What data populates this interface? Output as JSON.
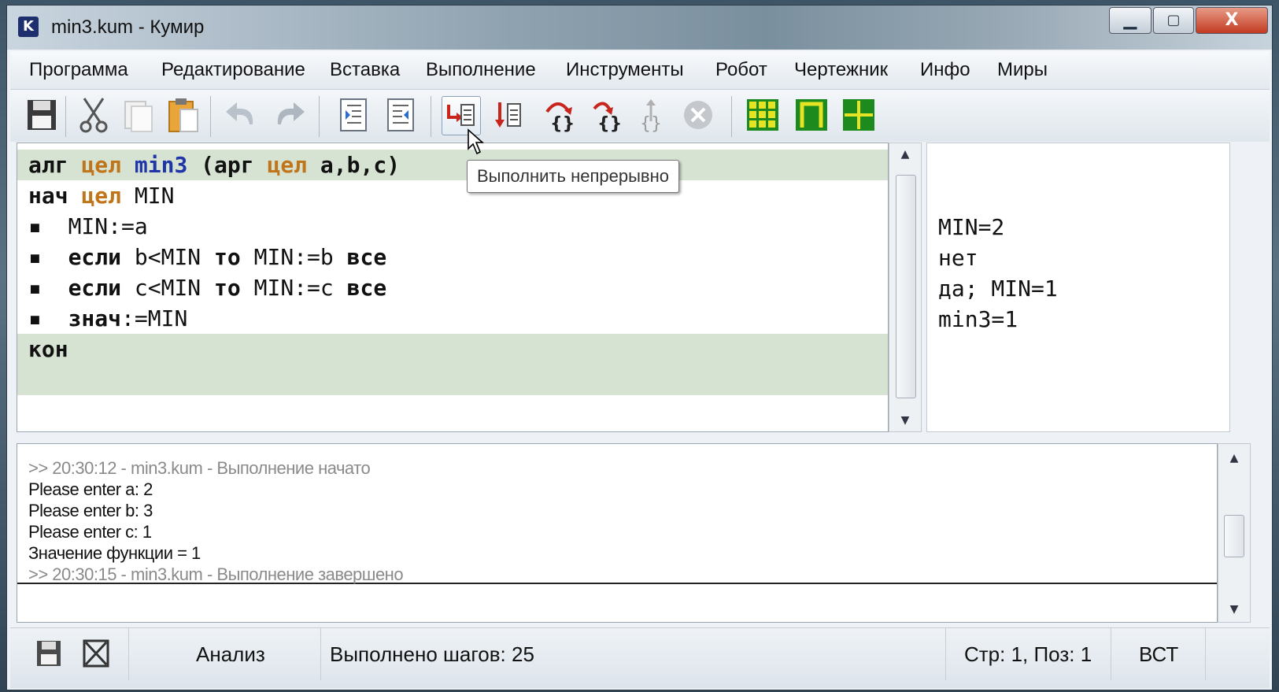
{
  "window": {
    "title": "min3.kum - Кумир",
    "app_icon_letter": "K",
    "min_glyph": "▁",
    "max_glyph": "▢",
    "close_glyph": "X"
  },
  "menu": [
    "Программа",
    "Редактирование",
    "Вставка",
    "Выполнение",
    "Инструменты",
    "Робот",
    "Чертежник",
    "Инфо",
    "Миры"
  ],
  "toolbar": {
    "tooltip": "Выполнить непрерывно",
    "icons": [
      "save-icon",
      "cut-icon",
      "copy-icon",
      "paste-icon",
      "undo-icon",
      "redo-icon",
      "indent-icon",
      "unindent-icon",
      "run-continuous-icon",
      "run-step-icon",
      "step-over-icon",
      "step-into-icon",
      "step-out-icon",
      "stop-icon",
      "robot-field-icon",
      "robot-window-icon",
      "drawer-icon"
    ]
  },
  "editor": {
    "lines": [
      {
        "tokens": [
          [
            "kw",
            "алг"
          ],
          [
            "sp",
            " "
          ],
          [
            "ty",
            "цел"
          ],
          [
            "sp",
            " "
          ],
          [
            "fn",
            "min3"
          ],
          [
            "sp",
            " "
          ],
          [
            "kw",
            "(арг"
          ],
          [
            "sp",
            " "
          ],
          [
            "ty",
            "цел"
          ],
          [
            "sp",
            " "
          ],
          [
            "kw",
            "a,b,c)"
          ]
        ]
      },
      {
        "tokens": [
          [
            "kw",
            "нач"
          ],
          [
            "sp",
            " "
          ],
          [
            "ty",
            "цел"
          ],
          [
            "sp",
            " "
          ],
          [
            "nm",
            "MIN"
          ]
        ]
      },
      {
        "tokens": [
          [
            "bul",
            "▪"
          ],
          [
            "sp",
            "  "
          ],
          [
            "nm",
            "MIN:=a"
          ]
        ]
      },
      {
        "tokens": [
          [
            "bul",
            "▪"
          ],
          [
            "sp",
            "  "
          ],
          [
            "kw",
            "если"
          ],
          [
            "sp",
            " "
          ],
          [
            "nm",
            "b<MIN"
          ],
          [
            "sp",
            " "
          ],
          [
            "kw",
            "то"
          ],
          [
            "sp",
            " "
          ],
          [
            "nm",
            "MIN:=b"
          ],
          [
            "sp",
            " "
          ],
          [
            "kw",
            "все"
          ]
        ]
      },
      {
        "tokens": [
          [
            "bul",
            "▪"
          ],
          [
            "sp",
            "  "
          ],
          [
            "kw",
            "если"
          ],
          [
            "sp",
            " "
          ],
          [
            "nm",
            "c<MIN"
          ],
          [
            "sp",
            " "
          ],
          [
            "kw",
            "то"
          ],
          [
            "sp",
            " "
          ],
          [
            "nm",
            "MIN:=c"
          ],
          [
            "sp",
            " "
          ],
          [
            "kw",
            "все"
          ]
        ]
      },
      {
        "tokens": [
          [
            "bul",
            "▪"
          ],
          [
            "sp",
            "  "
          ],
          [
            "kw",
            "знач"
          ],
          [
            "nm",
            ":=MIN"
          ]
        ]
      },
      {
        "tokens": [
          [
            "kw",
            "кон"
          ]
        ]
      }
    ]
  },
  "margin": [
    "MIN=2",
    "нет",
    "да; MIN=1",
    "min3=1"
  ],
  "console": {
    "lines": [
      {
        "text": ">> 20:30:12 - min3.kum - Выполнение начато",
        "gray": true
      },
      {
        "text": "Please enter a: 2",
        "gray": false
      },
      {
        "text": "Please enter b: 3",
        "gray": false
      },
      {
        "text": "Please enter c: 1",
        "gray": false
      },
      {
        "text": "Значение функции = 1",
        "gray": false
      },
      {
        "text": ">> 20:30:15 - min3.kum - Выполнение завершено",
        "gray": true
      }
    ]
  },
  "status": {
    "mode": "Анализ",
    "steps": "Выполнено шагов: 25",
    "position": "Стр: 1, Поз: 1",
    "insert_mode": "ВСТ"
  }
}
